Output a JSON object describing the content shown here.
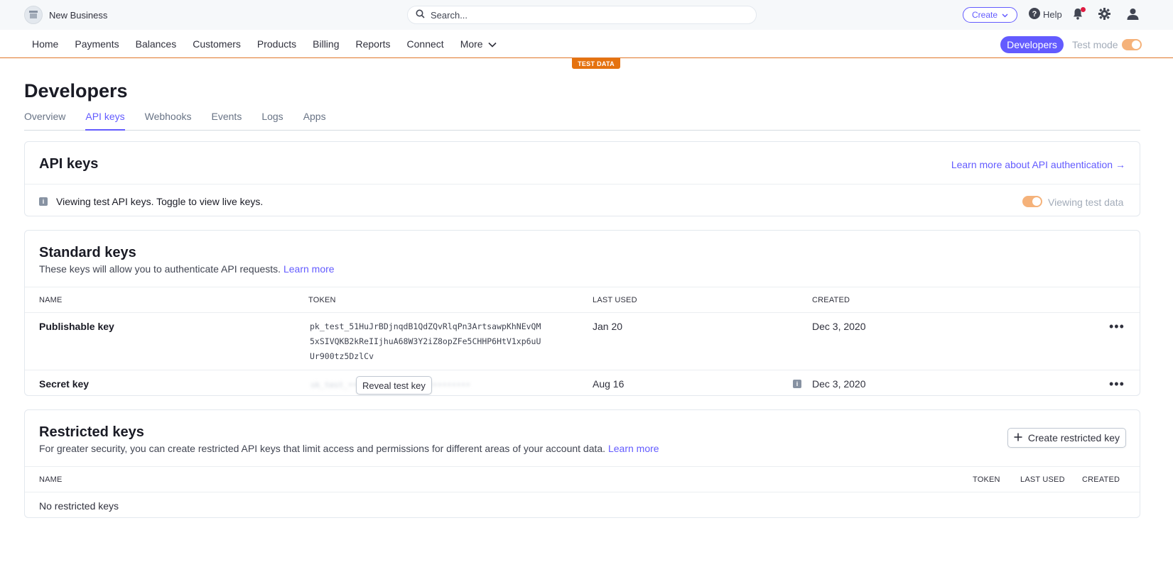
{
  "topbar": {
    "account_name": "New Business",
    "search_placeholder": "Search...",
    "create_label": "Create",
    "help_label": "Help"
  },
  "nav": {
    "items": [
      "Home",
      "Payments",
      "Balances",
      "Customers",
      "Products",
      "Billing",
      "Reports",
      "Connect",
      "More"
    ],
    "developers_label": "Developers",
    "test_mode_label": "Test mode",
    "test_data_badge": "TEST DATA"
  },
  "page": {
    "title": "Developers",
    "tabs": [
      "Overview",
      "API keys",
      "Webhooks",
      "Events",
      "Logs",
      "Apps"
    ],
    "active_tab": "API keys"
  },
  "api_keys_card": {
    "title": "API keys",
    "learn_more_link": "Learn more about API authentication →",
    "info_text": "Viewing test API keys. Toggle to view live keys.",
    "toggle_label": "Viewing test data"
  },
  "standard_keys": {
    "title": "Standard keys",
    "description": "These keys will allow you to authenticate API requests.",
    "learn_more": "Learn more",
    "columns": [
      "NAME",
      "TOKEN",
      "LAST USED",
      "CREATED"
    ],
    "rows": [
      {
        "name": "Publishable key",
        "token_lines": [
          "pk_test_51HuJrBDjnqdB1QdZQvRlqPn3ArtsawpKhNEvQM",
          "5xSIVQKB2kReIIjhuA68W3Y2iZ8opZFe5CHHP6HtV1xp6uU",
          "Ur900tz5DzlCv"
        ],
        "last_used": "Jan 20",
        "created": "Dec 3, 2020"
      },
      {
        "name": "Secret key",
        "reveal_label": "Reveal test key",
        "last_used": "Aug 16",
        "created": "Dec 3, 2020"
      }
    ]
  },
  "restricted_keys": {
    "title": "Restricted keys",
    "description": "For greater security, you can create restricted API keys that limit access and permissions for different areas of your account data.",
    "learn_more": "Learn more",
    "create_label": "Create restricted key",
    "columns": [
      "NAME",
      "TOKEN",
      "LAST USED",
      "CREATED"
    ],
    "empty_text": "No restricted keys"
  },
  "colors": {
    "accent": "#635bff",
    "test_orange": "#e5720f",
    "toggle": "#f5b27a"
  }
}
